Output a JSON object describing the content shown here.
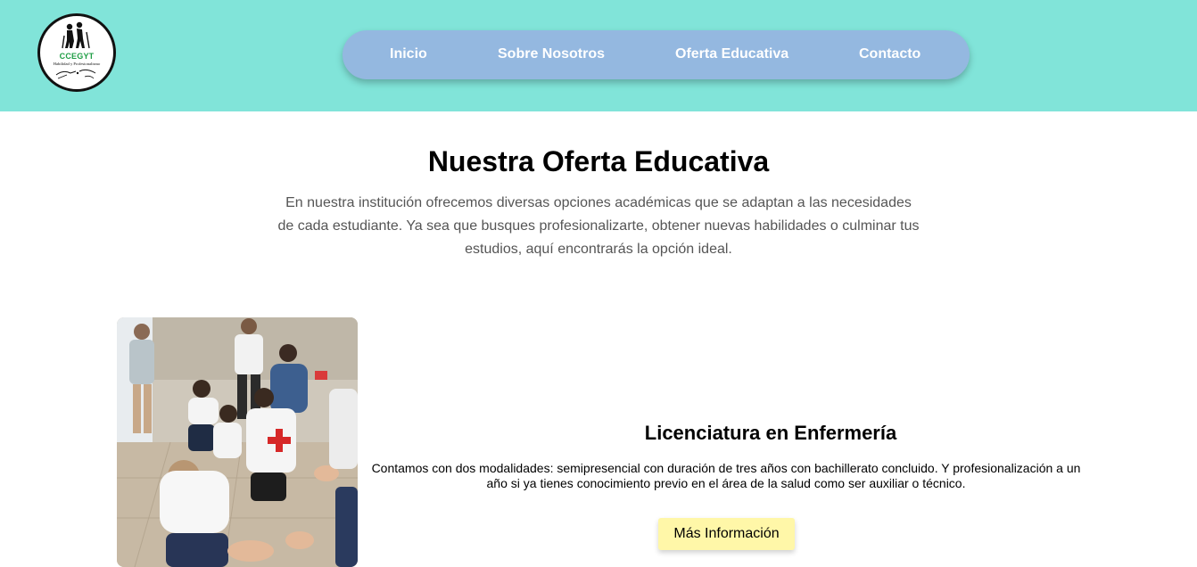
{
  "brand": {
    "logo_name": "CCEGYT",
    "logo_tagline": "Habilidad y Profesionalismo"
  },
  "nav": {
    "items": [
      {
        "label": "Inicio"
      },
      {
        "label": "Sobre Nosotros"
      },
      {
        "label": "Oferta Educativa"
      },
      {
        "label": "Contacto"
      }
    ]
  },
  "main": {
    "title": "Nuestra Oferta Educativa",
    "intro": "En nuestra institución ofrecemos diversas opciones académicas que se adaptan a las necesidades de cada estudiante. Ya sea que busques profesionalizarte, obtener nuevas habilidades o culminar tus estudios, aquí encontrarás la opción ideal."
  },
  "courses": [
    {
      "title": "Licenciatura en Enfermería",
      "description": "Contamos con dos modalidades: semipresencial con duración de tres años con bachillerato concluido. Y profesionalización a un año si ya tienes conocimiento previo en el área de la salud como ser auxiliar o técnico.",
      "button_label": "Más Información",
      "image": "nursing-students-cpr-practice-photo"
    }
  ],
  "colors": {
    "header_bg": "#81e4d9",
    "nav_bg": "#94b8e0",
    "nav_text": "#ffffff",
    "button_bg": "#fff7a8",
    "logo_accent": "#1f9e45",
    "intro_text": "#555555"
  }
}
